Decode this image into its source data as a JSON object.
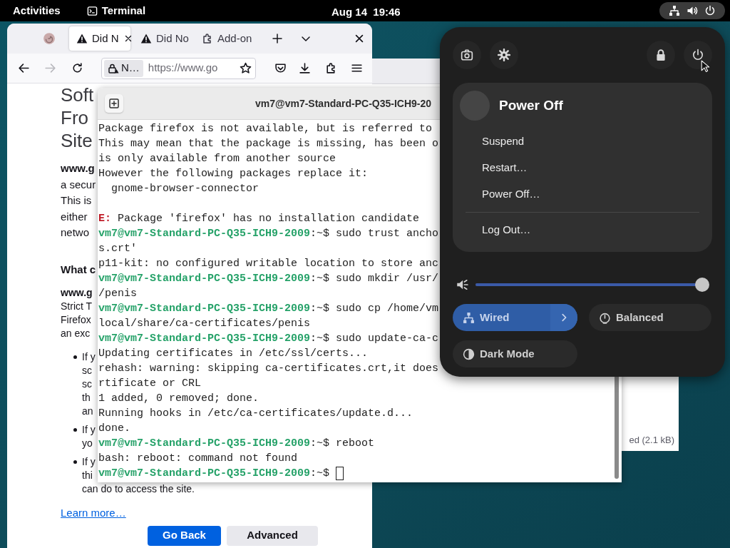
{
  "top_bar": {
    "activities": "Activities",
    "app": "Terminal",
    "clock": "Aug 14  19:46"
  },
  "back_window": {
    "status_text": "ed (2.1 kB)"
  },
  "browser": {
    "tabs": [
      {
        "label": "Did N",
        "kind": "warning",
        "selected": true
      },
      {
        "label": "Did No",
        "kind": "warning",
        "selected": false
      },
      {
        "label": "Add-on",
        "kind": "addon",
        "selected": false
      }
    ],
    "nav": [
      {
        "kind": "back",
        "disabled": false
      },
      {
        "kind": "forward",
        "disabled": true
      },
      {
        "kind": "reload",
        "disabled": false
      }
    ],
    "identity": "N…",
    "url": "https://www.go",
    "page": [
      {
        "kind": "heading",
        "lines": [
          {
            "text": "Soft",
            "bold": false
          },
          {
            "text": "Fro",
            "bold": false
          },
          {
            "text": "Site",
            "bold": false
          }
        ]
      },
      {
        "kind": "para",
        "lines": [
          {
            "text": "www.g",
            "bold": true
          },
          {
            "text": "a secur",
            "bold": false
          },
          {
            "text": "This is",
            "bold": false
          },
          {
            "text": "either",
            "bold": false
          },
          {
            "text": "netwo",
            "bold": false
          }
        ]
      },
      {
        "kind": "subheading",
        "lines": [
          {
            "text": "What c",
            "bold": true
          }
        ]
      },
      {
        "kind": "small",
        "lines": [
          {
            "text": "www.g",
            "bold": true
          },
          {
            "text": "Strict T",
            "bold": false
          },
          {
            "text": "Firefox",
            "bold": false
          },
          {
            "text": "an exc",
            "bold": false
          }
        ]
      },
      {
        "kind": "bullet",
        "lines": [
          {
            "text": "If y",
            "bold": false
          },
          {
            "text": "sc",
            "bold": false
          },
          {
            "text": "sc",
            "bold": false
          },
          {
            "text": "th",
            "bold": false
          },
          {
            "text": "an",
            "bold": false
          }
        ]
      },
      {
        "kind": "bullet",
        "lines": [
          {
            "text": "If y",
            "bold": false
          },
          {
            "text": "yo",
            "bold": false
          }
        ]
      },
      {
        "kind": "bullet",
        "lines": [
          {
            "text": "If y",
            "bold": false
          },
          {
            "text": "thi",
            "bold": false
          },
          {
            "text": "can do to access the site.",
            "bold": false
          }
        ]
      },
      {
        "kind": "link",
        "lines": [
          {
            "text": "Learn more…",
            "bold": false
          }
        ]
      }
    ],
    "buttons": [
      {
        "label": "Go Back",
        "kind": "primary"
      },
      {
        "label": "Advanced",
        "kind": "secondary"
      }
    ]
  },
  "terminal": {
    "title": "vm7@vm7-Standard-PC-Q35-ICH9-20",
    "cursor": true,
    "lines": [
      {
        "kind": "output",
        "text": "Package firefox is not available, but is referred to"
      },
      {
        "kind": "output",
        "text": "This may mean that the package is missing, has been o"
      },
      {
        "kind": "output",
        "text": "is only available from another source"
      },
      {
        "kind": "output",
        "text": "However the following packages replace it:"
      },
      {
        "kind": "output",
        "text": "  gnome-browser-connector"
      },
      {
        "kind": "blank"
      },
      {
        "kind": "error",
        "label": "E:",
        "text": " Package 'firefox' has no installation candidate"
      },
      {
        "kind": "prompt",
        "user_host": "vm7@vm7-Standard-PC-Q35-ICH9-2009",
        "path": ":~$",
        "command": " sudo trust ancho"
      },
      {
        "kind": "output",
        "text": "s.crt'"
      },
      {
        "kind": "output",
        "text": "p11-kit: no configured writable location to store anc"
      },
      {
        "kind": "prompt",
        "user_host": "vm7@vm7-Standard-PC-Q35-ICH9-2009",
        "path": ":~$",
        "command": " sudo mkdir /usr/"
      },
      {
        "kind": "output",
        "text": "/penis"
      },
      {
        "kind": "prompt",
        "user_host": "vm7@vm7-Standard-PC-Q35-ICH9-2009",
        "path": ":~$",
        "command": " sudo cp /home/vm"
      },
      {
        "kind": "output",
        "text": "local/share/ca-certificates/penis"
      },
      {
        "kind": "prompt",
        "user_host": "vm7@vm7-Standard-PC-Q35-ICH9-2009",
        "path": ":~$",
        "command": " sudo update-ca-c"
      },
      {
        "kind": "output",
        "text": "Updating certificates in /etc/ssl/certs..."
      },
      {
        "kind": "output",
        "text": "rehash: warning: skipping ca-certificates.crt,it does"
      },
      {
        "kind": "output",
        "text": "rtificate or CRL"
      },
      {
        "kind": "output",
        "text": "1 added, 0 removed; done."
      },
      {
        "kind": "output",
        "text": "Running hooks in /etc/ca-certificates/update.d..."
      },
      {
        "kind": "output",
        "text": "done."
      },
      {
        "kind": "prompt",
        "user_host": "vm7@vm7-Standard-PC-Q35-ICH9-2009",
        "path": ":~$",
        "command": " reboot"
      },
      {
        "kind": "output",
        "text": "bash: reboot: command not found"
      },
      {
        "kind": "prompt",
        "user_host": "vm7@vm7-Standard-PC-Q35-ICH9-2009",
        "path": ":~$"
      }
    ]
  },
  "quick_settings": {
    "power_menu": {
      "title": "Power Off",
      "items": [
        {
          "label": "Suspend",
          "separator_before": false
        },
        {
          "label": "Restart…",
          "separator_before": false
        },
        {
          "label": "Power Off…",
          "separator_before": false
        },
        {
          "label": "Log Out…",
          "separator_before": true
        }
      ]
    },
    "volume": {
      "level": 1.0
    },
    "toggles": [
      {
        "label": "Wired",
        "kind": "network",
        "on": true,
        "has_menu": true
      },
      {
        "label": "Balanced",
        "kind": "power_mode",
        "on": false,
        "has_menu": false
      },
      {
        "label": "Dark Mode",
        "kind": "dark_mode",
        "on": false,
        "has_menu": false
      }
    ]
  }
}
